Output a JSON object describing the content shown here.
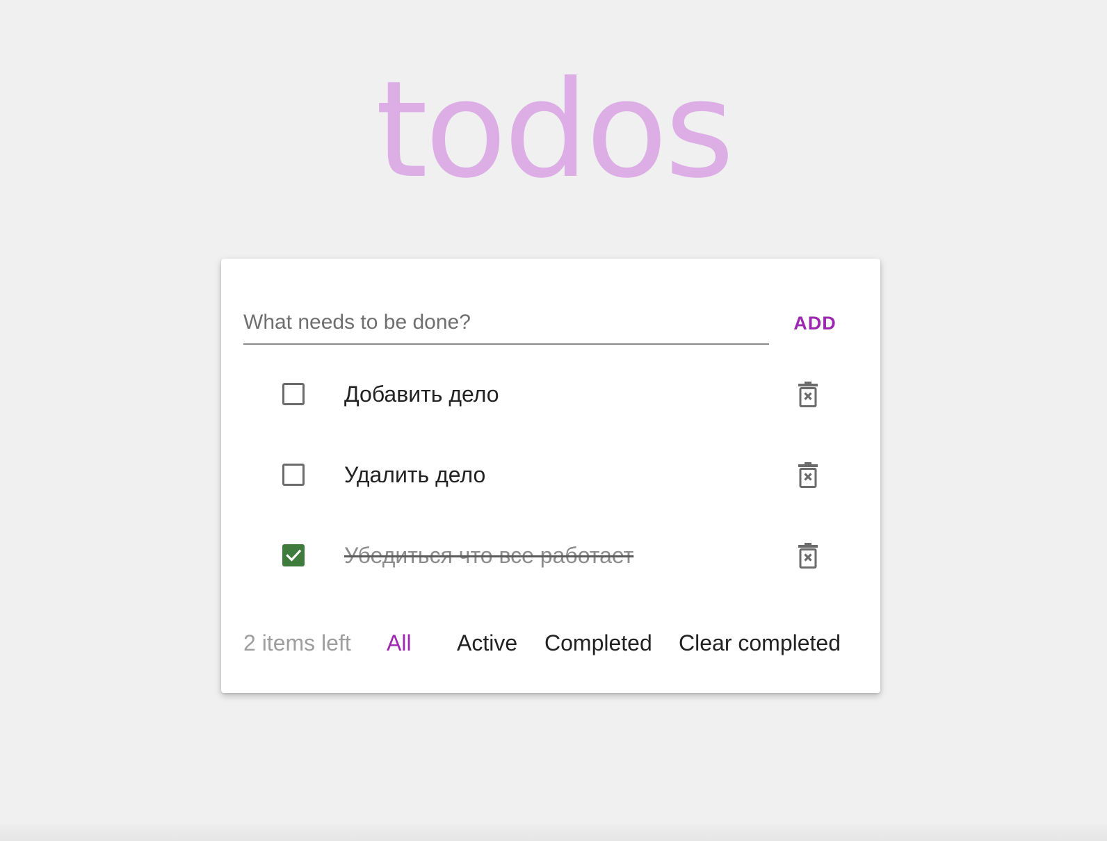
{
  "app": {
    "title": "todos",
    "title_color": "#dcaee5",
    "accent_color": "#9c27b0",
    "checked_color": "#3e7b3c"
  },
  "new_todo": {
    "placeholder": "What needs to be done?",
    "value": "",
    "add_label": "ADD"
  },
  "todos": [
    {
      "label": "Добавить дело",
      "completed": false,
      "checkbox_icon": "checkbox-empty-icon",
      "delete_icon": "trash-icon"
    },
    {
      "label": "Удалить дело",
      "completed": false,
      "checkbox_icon": "checkbox-empty-icon",
      "delete_icon": "trash-icon"
    },
    {
      "label": "Убедиться что все работает",
      "completed": true,
      "checkbox_icon": "checkbox-checked-icon",
      "delete_icon": "trash-icon"
    }
  ],
  "footer": {
    "items_left": "2 items left",
    "filters": [
      "All",
      "Active",
      "Completed"
    ],
    "selected_filter": "All",
    "clear_completed": "Clear completed"
  }
}
